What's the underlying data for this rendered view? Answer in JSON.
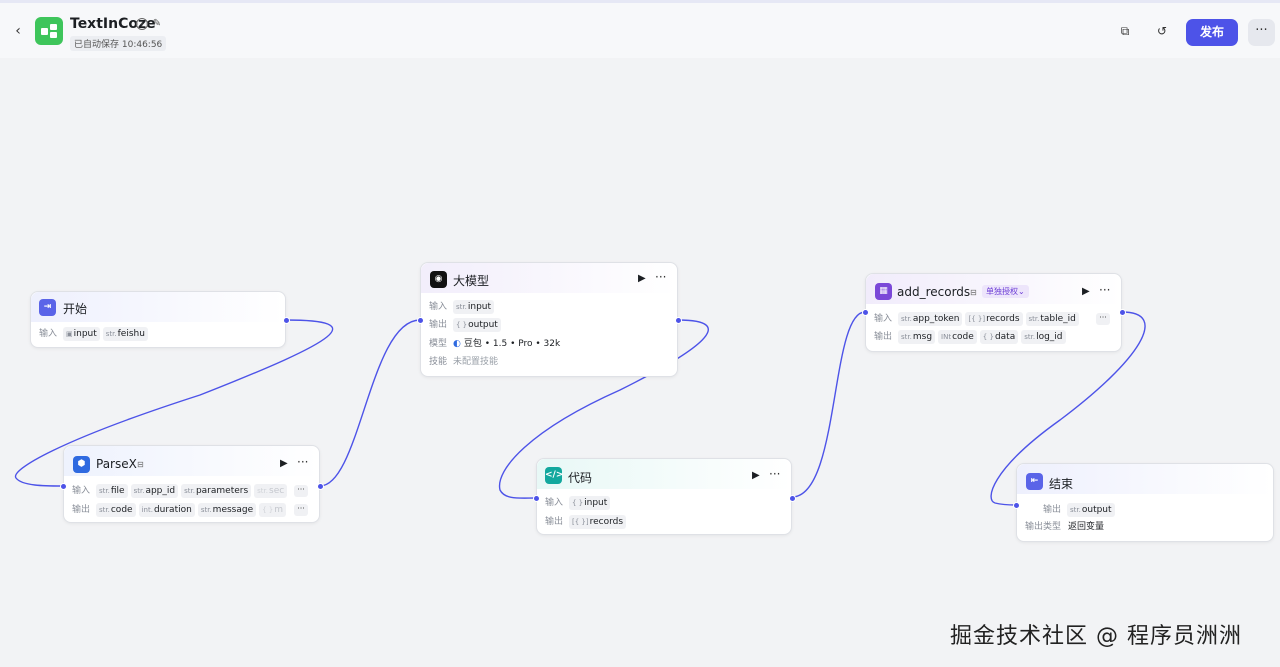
{
  "header": {
    "back_icon": "chevron-left-icon",
    "app_title": "TextInCoze",
    "autosave_text": "已自动保存 10:46:56",
    "publish_label": "发布",
    "more_label": "···"
  },
  "colors": {
    "accent": "#4d53e8",
    "app_logo": "#3ec55b",
    "edge": "#4d53e8"
  },
  "nodes": {
    "start": {
      "title": "开始",
      "input_label": "输入",
      "inputs": [
        {
          "type": "",
          "name": "input"
        },
        {
          "type": "str.",
          "name": "feishu"
        }
      ]
    },
    "parsex": {
      "title": "ParseX",
      "input_label": "输入",
      "output_label": "输出",
      "inputs": [
        {
          "type": "str.",
          "name": "file"
        },
        {
          "type": "str.",
          "name": "app_id"
        },
        {
          "type": "str.",
          "name": "parameters"
        },
        {
          "type": "str.",
          "name": "sec"
        }
      ],
      "outputs": [
        {
          "type": "str.",
          "name": "code"
        },
        {
          "type": "int.",
          "name": "duration"
        },
        {
          "type": "str.",
          "name": "message"
        },
        {
          "type": "{ }",
          "name": "m"
        }
      ]
    },
    "llm": {
      "title": "大模型",
      "input_label": "输入",
      "output_label": "输出",
      "model_label": "模型",
      "skill_label": "技能",
      "input": {
        "type": "str.",
        "name": "input"
      },
      "output": {
        "type": "{ }",
        "name": "output"
      },
      "model_value": "豆包 • 1.5 • Pro • 32k",
      "skill_value": "未配置技能"
    },
    "code": {
      "title": "代码",
      "input_label": "输入",
      "output_label": "输出",
      "input": {
        "type": "{ }",
        "name": "input"
      },
      "output": {
        "type": "[{ }]",
        "name": "records"
      }
    },
    "add_records": {
      "title": "add_records",
      "auth_badge": "单独授权⌄",
      "input_label": "输入",
      "output_label": "输出",
      "inputs": [
        {
          "type": "str.",
          "name": "app_token"
        },
        {
          "type": "[{ }]",
          "name": "records"
        },
        {
          "type": "str.",
          "name": "table_id"
        }
      ],
      "outputs": [
        {
          "type": "str.",
          "name": "msg"
        },
        {
          "type": "INt",
          "name": "code"
        },
        {
          "type": "{ }",
          "name": "data"
        },
        {
          "type": "str.",
          "name": "log_id"
        }
      ]
    },
    "end": {
      "title": "结束",
      "output_label": "输出",
      "output": {
        "type": "str.",
        "name": "output"
      },
      "output_type_label": "输出类型",
      "output_type_value": "返回变量"
    }
  },
  "watermark": "掘金技术社区 @ 程序员洲洲"
}
